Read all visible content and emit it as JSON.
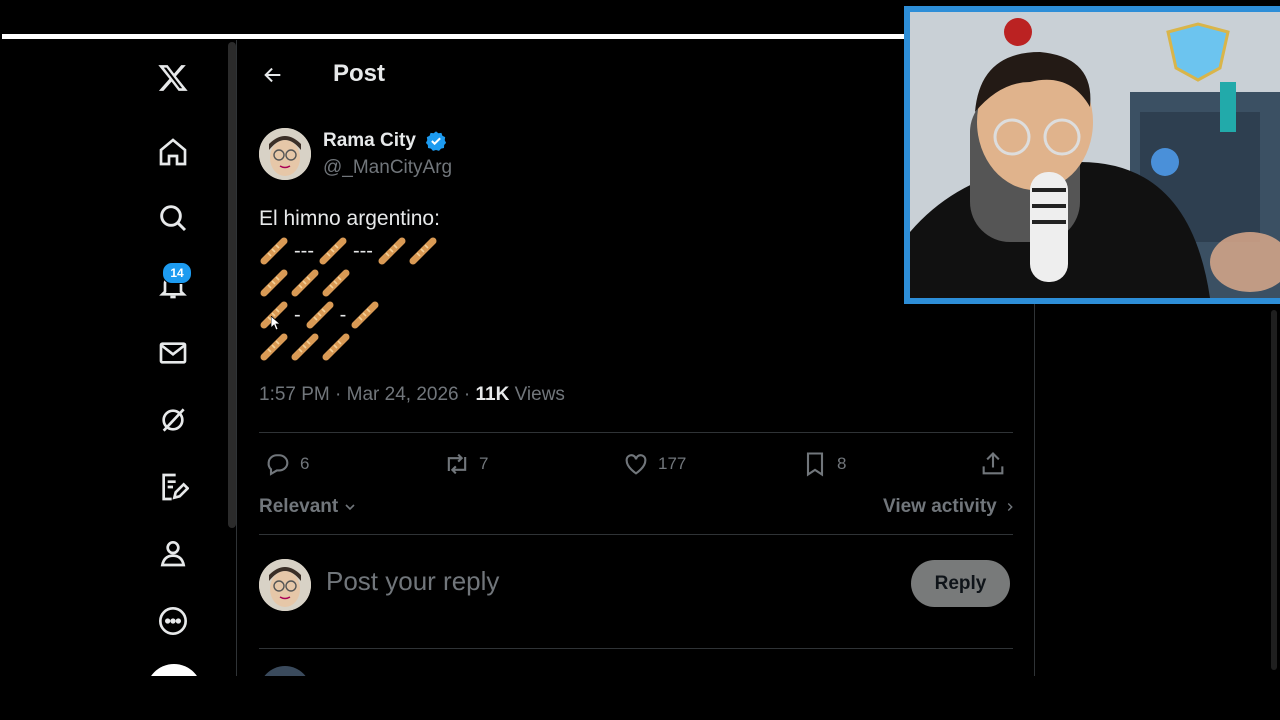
{
  "nav": {
    "items": [
      "x-logo",
      "home-icon",
      "search-icon",
      "notifications-icon",
      "messages-icon",
      "grok-icon",
      "premium-icon",
      "profile-icon",
      "more-icon"
    ],
    "notification_count": "14"
  },
  "header": {
    "title": "Post"
  },
  "tweet": {
    "author_name": "Rama City",
    "handle": "@_ManCityArg",
    "text_intro": "El himno argentino:",
    "time": "1:57 PM · Mar 24, 2026 · ",
    "views_count": "11K",
    "views_label": " Views",
    "replies": "6",
    "reposts": "7",
    "likes": "177",
    "bookmarks": "8"
  },
  "sort": {
    "label": "Relevant",
    "view_activity": "View activity"
  },
  "reply": {
    "placeholder": "Post your reply",
    "button": "Reply"
  },
  "colors": {
    "accent": "#1d9bf0",
    "muted": "#71767b",
    "text": "#e7e9ea",
    "background": "#000000"
  }
}
